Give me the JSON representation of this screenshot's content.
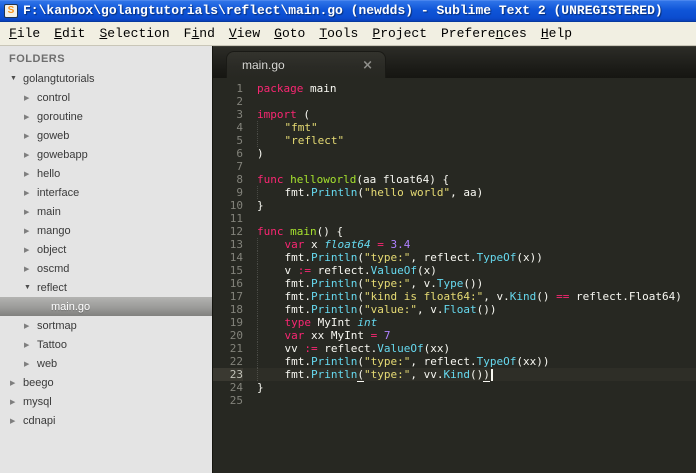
{
  "window": {
    "title": "F:\\kanbox\\golangtutorials\\reflect\\main.go (newdds) - Sublime Text 2 (UNREGISTERED)"
  },
  "icons": {
    "app_logo_glyph": "S",
    "expanded": "▼",
    "collapsed": "▶",
    "tab_close": "×"
  },
  "menu": {
    "items": [
      {
        "label": "File",
        "u": 0
      },
      {
        "label": "Edit",
        "u": 0
      },
      {
        "label": "Selection",
        "u": 0
      },
      {
        "label": "Find",
        "u": 1
      },
      {
        "label": "View",
        "u": 0
      },
      {
        "label": "Goto",
        "u": 0
      },
      {
        "label": "Tools",
        "u": 0
      },
      {
        "label": "Project",
        "u": 0
      },
      {
        "label": "Preferences",
        "u": 7
      },
      {
        "label": "Help",
        "u": 0
      }
    ]
  },
  "sidebar": {
    "header": "FOLDERS",
    "items": [
      {
        "label": "golangtutorials",
        "depth": 0,
        "arrow": "expanded",
        "selected": false
      },
      {
        "label": "control",
        "depth": 1,
        "arrow": "collapsed",
        "selected": false
      },
      {
        "label": "goroutine",
        "depth": 1,
        "arrow": "collapsed",
        "selected": false
      },
      {
        "label": "goweb",
        "depth": 1,
        "arrow": "collapsed",
        "selected": false
      },
      {
        "label": "gowebapp",
        "depth": 1,
        "arrow": "collapsed",
        "selected": false
      },
      {
        "label": "hello",
        "depth": 1,
        "arrow": "collapsed",
        "selected": false
      },
      {
        "label": "interface",
        "depth": 1,
        "arrow": "collapsed",
        "selected": false
      },
      {
        "label": "main",
        "depth": 1,
        "arrow": "collapsed",
        "selected": false
      },
      {
        "label": "mango",
        "depth": 1,
        "arrow": "collapsed",
        "selected": false
      },
      {
        "label": "object",
        "depth": 1,
        "arrow": "collapsed",
        "selected": false
      },
      {
        "label": "oscmd",
        "depth": 1,
        "arrow": "collapsed",
        "selected": false
      },
      {
        "label": "reflect",
        "depth": 1,
        "arrow": "expanded",
        "selected": false
      },
      {
        "label": "main.go",
        "depth": 2,
        "arrow": "none",
        "selected": true
      },
      {
        "label": "sortmap",
        "depth": 1,
        "arrow": "collapsed",
        "selected": false
      },
      {
        "label": "Tattoo",
        "depth": 1,
        "arrow": "collapsed",
        "selected": false
      },
      {
        "label": "web",
        "depth": 1,
        "arrow": "collapsed",
        "selected": false
      },
      {
        "label": "beego",
        "depth": 0,
        "arrow": "collapsed",
        "selected": false
      },
      {
        "label": "mysql",
        "depth": 0,
        "arrow": "collapsed",
        "selected": false
      },
      {
        "label": "cdnapi",
        "depth": 0,
        "arrow": "collapsed",
        "selected": false
      }
    ]
  },
  "editor": {
    "tab": {
      "label": "main.go",
      "active": true
    },
    "current_line": 23,
    "lines": [
      {
        "n": 1,
        "tokens": [
          [
            "k",
            "package"
          ],
          [
            "p",
            " main"
          ]
        ]
      },
      {
        "n": 2,
        "tokens": []
      },
      {
        "n": 3,
        "tokens": [
          [
            "k",
            "import"
          ],
          [
            "p",
            " ("
          ]
        ]
      },
      {
        "n": 4,
        "tokens": [
          [
            "ind",
            "    "
          ],
          [
            "s",
            "\"fmt\""
          ]
        ]
      },
      {
        "n": 5,
        "tokens": [
          [
            "ind",
            "    "
          ],
          [
            "s",
            "\"reflect\""
          ]
        ]
      },
      {
        "n": 6,
        "tokens": [
          [
            "p",
            ")"
          ]
        ]
      },
      {
        "n": 7,
        "tokens": []
      },
      {
        "n": 8,
        "tokens": [
          [
            "k",
            "func"
          ],
          [
            "p",
            " "
          ],
          [
            "fn",
            "helloworld"
          ],
          [
            "p",
            "(aa float64) {"
          ]
        ]
      },
      {
        "n": 9,
        "tokens": [
          [
            "ind",
            "    "
          ],
          [
            "p",
            "fmt."
          ],
          [
            "f",
            "Println"
          ],
          [
            "p",
            "("
          ],
          [
            "s",
            "\"hello world\""
          ],
          [
            "p",
            ", aa)"
          ]
        ]
      },
      {
        "n": 10,
        "tokens": [
          [
            "p",
            "}"
          ]
        ]
      },
      {
        "n": 11,
        "tokens": []
      },
      {
        "n": 12,
        "tokens": [
          [
            "k",
            "func"
          ],
          [
            "p",
            " "
          ],
          [
            "fn",
            "main"
          ],
          [
            "p",
            "() {"
          ]
        ]
      },
      {
        "n": 13,
        "tokens": [
          [
            "ind",
            "    "
          ],
          [
            "k",
            "var"
          ],
          [
            "p",
            " x "
          ],
          [
            "t",
            "float64"
          ],
          [
            "p",
            " "
          ],
          [
            "k",
            "="
          ],
          [
            "p",
            " "
          ],
          [
            "n",
            "3.4"
          ]
        ]
      },
      {
        "n": 14,
        "tokens": [
          [
            "ind",
            "    "
          ],
          [
            "p",
            "fmt."
          ],
          [
            "f",
            "Println"
          ],
          [
            "p",
            "("
          ],
          [
            "s",
            "\"type:\""
          ],
          [
            "p",
            ", reflect."
          ],
          [
            "f",
            "TypeOf"
          ],
          [
            "p",
            "(x))"
          ]
        ]
      },
      {
        "n": 15,
        "tokens": [
          [
            "ind",
            "    "
          ],
          [
            "p",
            "v "
          ],
          [
            "k",
            ":="
          ],
          [
            "p",
            " reflect."
          ],
          [
            "f",
            "ValueOf"
          ],
          [
            "p",
            "(x)"
          ]
        ]
      },
      {
        "n": 16,
        "tokens": [
          [
            "ind",
            "    "
          ],
          [
            "p",
            "fmt."
          ],
          [
            "f",
            "Println"
          ],
          [
            "p",
            "("
          ],
          [
            "s",
            "\"type:\""
          ],
          [
            "p",
            ", v."
          ],
          [
            "f",
            "Type"
          ],
          [
            "p",
            "())"
          ]
        ]
      },
      {
        "n": 17,
        "tokens": [
          [
            "ind",
            "    "
          ],
          [
            "p",
            "fmt."
          ],
          [
            "f",
            "Println"
          ],
          [
            "p",
            "("
          ],
          [
            "s",
            "\"kind is float64:\""
          ],
          [
            "p",
            ", v."
          ],
          [
            "f",
            "Kind"
          ],
          [
            "p",
            "() "
          ],
          [
            "k",
            "=="
          ],
          [
            "p",
            " reflect.Float64)"
          ]
        ]
      },
      {
        "n": 18,
        "tokens": [
          [
            "ind",
            "    "
          ],
          [
            "p",
            "fmt."
          ],
          [
            "f",
            "Println"
          ],
          [
            "p",
            "("
          ],
          [
            "s",
            "\"value:\""
          ],
          [
            "p",
            ", v."
          ],
          [
            "f",
            "Float"
          ],
          [
            "p",
            "())"
          ]
        ]
      },
      {
        "n": 19,
        "tokens": [
          [
            "ind",
            "    "
          ],
          [
            "k",
            "type"
          ],
          [
            "p",
            " MyInt "
          ],
          [
            "t",
            "int"
          ]
        ]
      },
      {
        "n": 20,
        "tokens": [
          [
            "ind",
            "    "
          ],
          [
            "k",
            "var"
          ],
          [
            "p",
            " xx MyInt "
          ],
          [
            "k",
            "="
          ],
          [
            "p",
            " "
          ],
          [
            "n",
            "7"
          ]
        ]
      },
      {
        "n": 21,
        "tokens": [
          [
            "ind",
            "    "
          ],
          [
            "p",
            "vv "
          ],
          [
            "k",
            ":="
          ],
          [
            "p",
            " reflect."
          ],
          [
            "f",
            "ValueOf"
          ],
          [
            "p",
            "(xx)"
          ]
        ]
      },
      {
        "n": 22,
        "tokens": [
          [
            "ind",
            "    "
          ],
          [
            "p",
            "fmt."
          ],
          [
            "f",
            "Println"
          ],
          [
            "p",
            "("
          ],
          [
            "s",
            "\"type:\""
          ],
          [
            "p",
            ", reflect."
          ],
          [
            "f",
            "TypeOf"
          ],
          [
            "p",
            "(xx))"
          ]
        ]
      },
      {
        "n": 23,
        "tokens": [
          [
            "ind",
            "    "
          ],
          [
            "p",
            "fmt."
          ],
          [
            "f",
            "Println"
          ],
          [
            "pu",
            "("
          ],
          [
            "s",
            "\"type:\""
          ],
          [
            "p",
            ", vv."
          ],
          [
            "f",
            "Kind"
          ],
          [
            "p",
            "()"
          ],
          [
            "pu",
            ")"
          ],
          [
            "caret",
            ""
          ]
        ]
      },
      {
        "n": 24,
        "tokens": [
          [
            "p",
            "}"
          ]
        ]
      },
      {
        "n": 25,
        "tokens": []
      }
    ]
  },
  "colors": {
    "titlebar_blue": "#0f55d8",
    "menubar_bg": "#f1efe2",
    "sidebar_bg": "#e4e4e4",
    "editor_bg": "#272822",
    "keyword": "#f92672",
    "string": "#e6db74",
    "function_call": "#66d9ef",
    "function_def": "#a6e22e",
    "type_italic": "#66d9ef",
    "number": "#ae81ff",
    "foreground": "#f8f8f2"
  }
}
